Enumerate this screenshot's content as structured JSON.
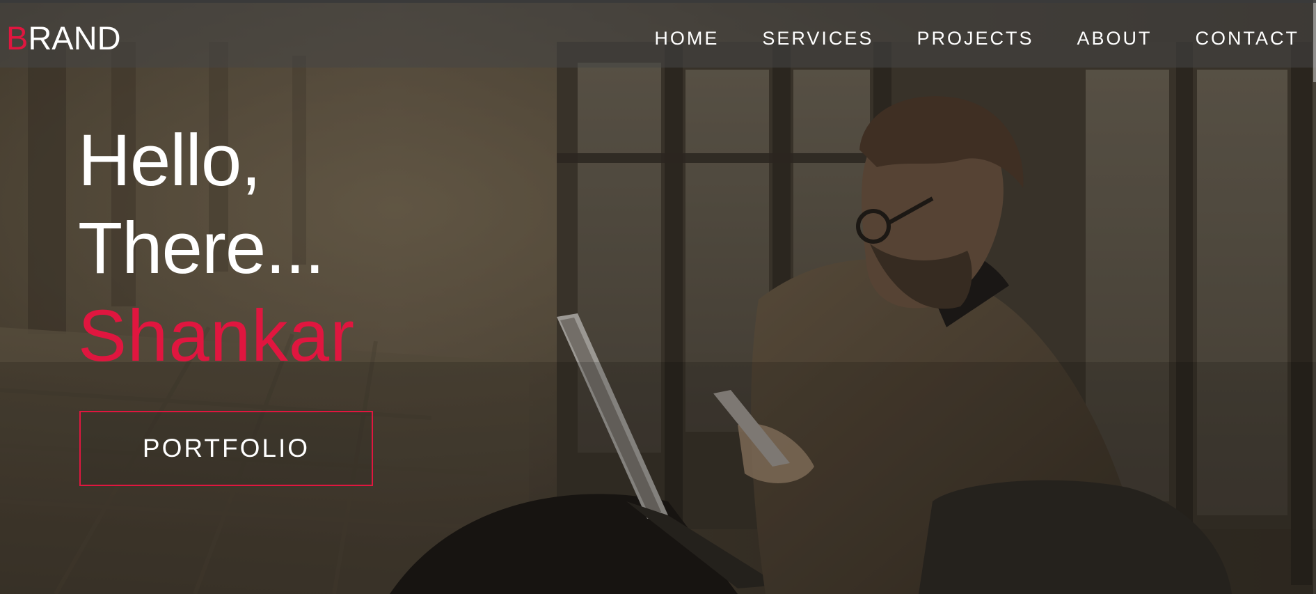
{
  "brand": {
    "first_letter": "B",
    "rest": "RAND",
    "accent_color": "#e0163f"
  },
  "nav": {
    "items": [
      "HOME",
      "SERVICES",
      "PROJECTS",
      "ABOUT",
      "CONTACT"
    ]
  },
  "hero": {
    "line1": "Hello,",
    "line2": "There...",
    "name": "Shankar",
    "button_label": "PORTFOLIO"
  },
  "colors": {
    "accent": "#e0163f",
    "text": "#ffffff",
    "nav_bg": "rgba(70,70,70,0.55)"
  }
}
